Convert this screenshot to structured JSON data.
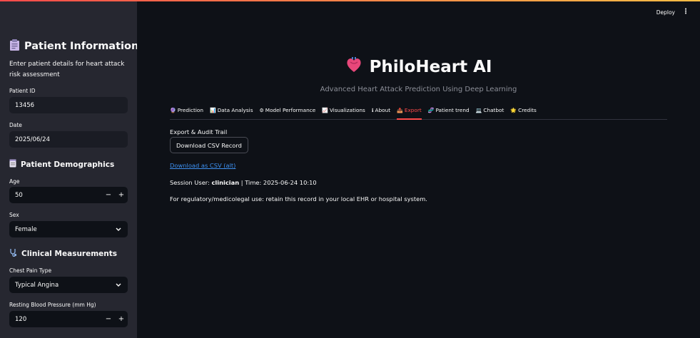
{
  "sidebar": {
    "title": "Patient Information",
    "title_icon": "clipboard-icon",
    "description": "Enter patient details for heart attack risk assessment",
    "patient_id": {
      "label": "Patient ID",
      "value": "13456"
    },
    "date": {
      "label": "Date",
      "value": "2025/06/24"
    },
    "demographics": {
      "title": "Patient Demographics",
      "icon": "notepad-icon"
    },
    "age": {
      "label": "Age",
      "value": "50",
      "minus": "−",
      "plus": "+"
    },
    "sex": {
      "label": "Sex",
      "value": "Female"
    },
    "clinical": {
      "title": "Clinical Measurements",
      "icon": "stethoscope-icon"
    },
    "chest_pain": {
      "label": "Chest Pain Type",
      "value": "Typical Angina"
    },
    "bp": {
      "label": "Resting Blood Pressure (mm Hg)",
      "value": "120",
      "minus": "−",
      "plus": "+"
    }
  },
  "header": {
    "deploy_label": "Deploy",
    "menu_glyph": "⋮"
  },
  "hero": {
    "title": "PhiloHeart AI",
    "subtitle": "Advanced Heart Attack Prediction Using Deep Learning"
  },
  "tabs": [
    {
      "icon": "🔮",
      "label": "Prediction"
    },
    {
      "icon": "📊",
      "label": "Data Analysis"
    },
    {
      "icon": "⚙",
      "label": "Model Performance"
    },
    {
      "icon": "📈",
      "label": "Visualizations"
    },
    {
      "icon": "ℹ",
      "label": "About"
    },
    {
      "icon": "📤",
      "label": "Export"
    },
    {
      "icon": "🧬",
      "label": "Patient trend"
    },
    {
      "icon": "💻",
      "label": "Chatbot"
    },
    {
      "icon": "🌟",
      "label": "Credits"
    }
  ],
  "active_tab": "Export",
  "export": {
    "heading": "Export & Audit Trail",
    "download_button": "Download CSV Record",
    "alt_link": "Download as CSV (alt)",
    "session_prefix": "Session User: ",
    "session_user": "clinician",
    "session_suffix": " | Time: 2025-06-24 10:10",
    "note": "For regulatory/medicolegal use: retain this record in your local EHR or hospital system."
  },
  "colors": {
    "accent": "#ff4b4b",
    "background": "#0e1117",
    "sidebar": "#262730",
    "link": "#3d8fef"
  }
}
